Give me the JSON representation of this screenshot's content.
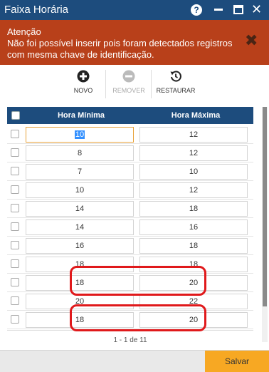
{
  "window": {
    "title": "Faixa Horária",
    "help_label": "?",
    "close_label": "✕"
  },
  "alert": {
    "title": "Atenção",
    "message": "Não foi possível inserir pois foram detectados registros com mesma chave de identificação.",
    "close_label": "✖"
  },
  "toolbar": {
    "novo_label": "NOVO",
    "remover_label": "REMOVER",
    "restaurar_label": "RESTAURAR"
  },
  "grid": {
    "col_min_label": "Hora Mínima",
    "col_max_label": "Hora Máxima",
    "rows": [
      {
        "min": "10",
        "max": "12"
      },
      {
        "min": "8",
        "max": "12"
      },
      {
        "min": "7",
        "max": "10"
      },
      {
        "min": "10",
        "max": "12"
      },
      {
        "min": "14",
        "max": "18"
      },
      {
        "min": "14",
        "max": "16"
      },
      {
        "min": "16",
        "max": "18"
      },
      {
        "min": "18",
        "max": "18"
      },
      {
        "min": "18",
        "max": "20"
      },
      {
        "min": "20",
        "max": "22"
      },
      {
        "min": "18",
        "max": "20"
      }
    ]
  },
  "pager": {
    "text": "1 - 1 de 11"
  },
  "footer": {
    "save_label": "Salvar"
  },
  "colors": {
    "title_bar": "#1d4c7d",
    "alert": "#b8401a",
    "save_button": "#f7a823",
    "highlight": "#e0191b"
  }
}
